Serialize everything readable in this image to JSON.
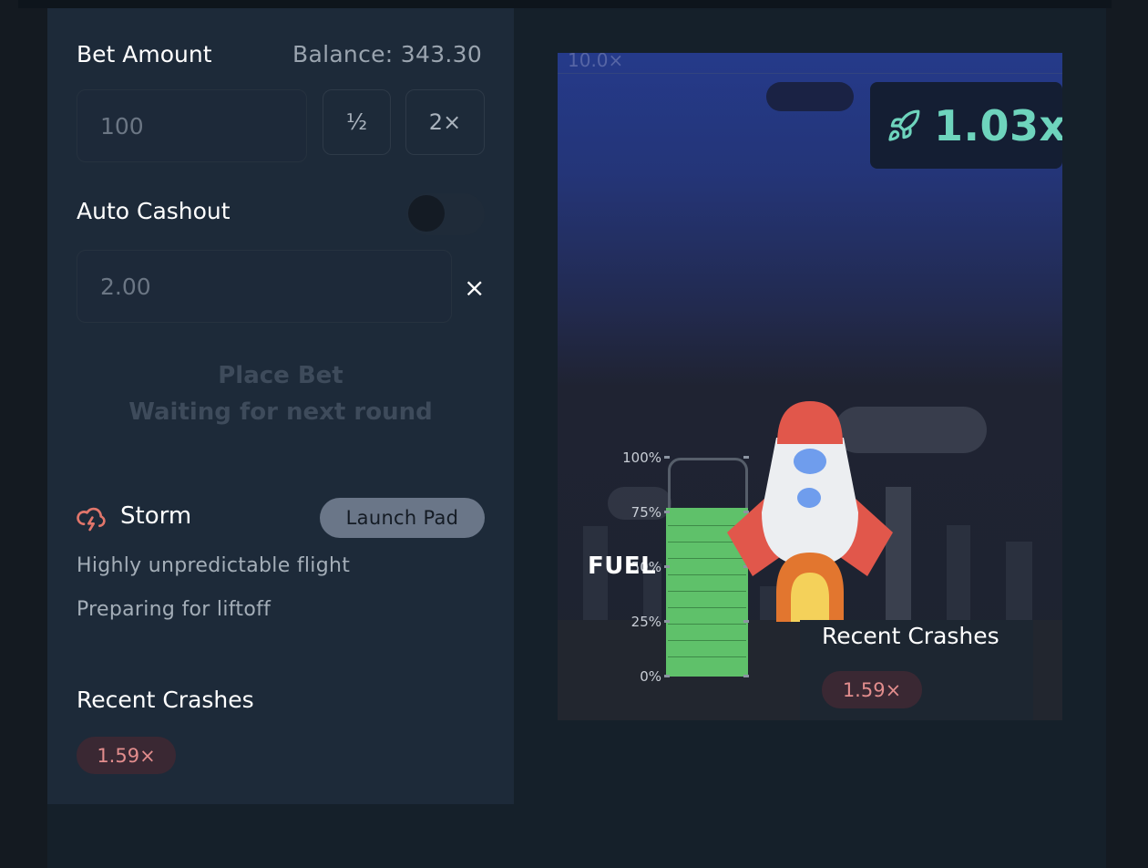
{
  "bet": {
    "label": "Bet Amount",
    "balance": "Balance: 343.30",
    "amount_placeholder": "100",
    "half_label": "½",
    "double_label": "2×"
  },
  "auto_cashout": {
    "label": "Auto Cashout",
    "enabled": false,
    "value_placeholder": "2.00",
    "clear_label": "×"
  },
  "place_bet": {
    "label": "Place Bet",
    "status": "Waiting for next round"
  },
  "mode": {
    "icon": "storm-cloud-lightning-icon",
    "name": "Storm",
    "badge": "Launch Pad",
    "description": "Highly unpredictable flight",
    "status": "Preparing for liftoff"
  },
  "recent_crashes": {
    "title": "Recent Crashes",
    "items": [
      "1.59×"
    ]
  },
  "game": {
    "scale_top_label": "10.0×",
    "multiplier": "1.03x",
    "multiplier_icon": "rocket-icon",
    "fuel": {
      "label": "FUEL",
      "ticks": [
        "100%",
        "75%",
        "50%",
        "25%",
        "0%"
      ],
      "level_percent": 77
    },
    "recent_crashes_title": "Recent Crashes",
    "recent_crashes_items": [
      "1.59×"
    ]
  },
  "colors": {
    "accent": "#6ed4bd",
    "panel": "#1d2a39",
    "crash_chip_text": "#e28d8d",
    "fuel": "#5fc16a"
  }
}
